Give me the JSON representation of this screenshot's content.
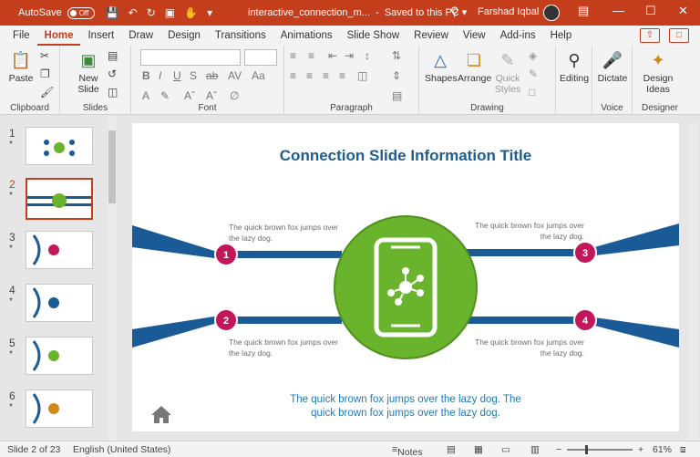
{
  "titlebar": {
    "autosave_label": "AutoSave",
    "toggle_state": "Off",
    "document_name": "interactive_connection_m...",
    "save_state": "Saved to this PC",
    "user_name": "Farshad Iqbal"
  },
  "tabs": [
    "File",
    "Home",
    "Insert",
    "Draw",
    "Design",
    "Transitions",
    "Animations",
    "Slide Show",
    "Review",
    "View",
    "Add-ins",
    "Help"
  ],
  "active_tab": "Home",
  "ribbon": {
    "paste": "Paste",
    "new_slide_line1": "New",
    "new_slide_line2": "Slide",
    "shapes": "Shapes",
    "arrange": "Arrange",
    "quick_styles_line1": "Quick",
    "quick_styles_line2": "Styles",
    "editing": "Editing",
    "dictate": "Dictate",
    "design_ideas_line1": "Design",
    "design_ideas_line2": "Ideas",
    "groups": {
      "clipboard": "Clipboard",
      "slides": "Slides",
      "font": "Font",
      "paragraph": "Paragraph",
      "drawing": "Drawing",
      "voice": "Voice",
      "designer": "Designer"
    }
  },
  "thumbnails": [
    {
      "num": "1",
      "star": "*"
    },
    {
      "num": "2",
      "star": "*"
    },
    {
      "num": "3",
      "star": "*"
    },
    {
      "num": "4",
      "star": "*"
    },
    {
      "num": "5",
      "star": "*"
    },
    {
      "num": "6",
      "star": "*"
    }
  ],
  "slide": {
    "title": "Connection Slide Information Title",
    "nodes": [
      "1",
      "2",
      "3",
      "4"
    ],
    "caption_tl": "The quick brown fox jumps over the lazy dog.",
    "caption_tr": "The quick brown fox jumps over the lazy dog.",
    "caption_bl": "The quick brown fox jumps over the lazy dog.",
    "caption_br": "The quick brown fox jumps over the lazy dog.",
    "footer": "The quick brown fox jumps over the lazy dog. The quick brown fox jumps over the lazy dog.",
    "colors": {
      "title": "#1f5d8f",
      "band": "#1a5a96",
      "node": "#c2185b",
      "circle": "#6ab42d"
    }
  },
  "status": {
    "slide_counter": "Slide 2 of 23",
    "language": "English (United States)",
    "notes": "Notes",
    "zoom": "61%"
  }
}
